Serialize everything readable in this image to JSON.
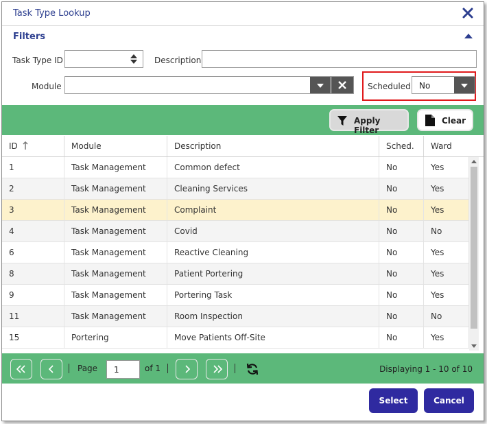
{
  "dialog": {
    "title": "Task Type Lookup"
  },
  "filters": {
    "heading": "Filters",
    "task_type_id_label": "Task Type ID",
    "task_type_id_value": "",
    "description_label": "Description",
    "description_value": "",
    "module_label": "Module",
    "module_value": "",
    "scheduled_label": "Scheduled",
    "scheduled_value": "No",
    "apply_label": "Apply Filter",
    "clear_label": "Clear"
  },
  "grid": {
    "columns": [
      "ID",
      "Module",
      "Description",
      "Sched.",
      "Ward"
    ],
    "rows": [
      {
        "id": "1",
        "module": "Task Management",
        "description": "Common defect",
        "sched": "No",
        "ward": "Yes"
      },
      {
        "id": "2",
        "module": "Task Management",
        "description": "Cleaning Services",
        "sched": "No",
        "ward": "Yes"
      },
      {
        "id": "3",
        "module": "Task Management",
        "description": "Complaint",
        "sched": "No",
        "ward": "Yes"
      },
      {
        "id": "4",
        "module": "Task Management",
        "description": "Covid",
        "sched": "No",
        "ward": "No"
      },
      {
        "id": "6",
        "module": "Task Management",
        "description": "Reactive Cleaning",
        "sched": "No",
        "ward": "Yes"
      },
      {
        "id": "8",
        "module": "Task Management",
        "description": "Patient Portering",
        "sched": "No",
        "ward": "Yes"
      },
      {
        "id": "9",
        "module": "Task Management",
        "description": "Portering Task",
        "sched": "No",
        "ward": "Yes"
      },
      {
        "id": "11",
        "module": "Task Management",
        "description": "Room Inspection",
        "sched": "No",
        "ward": "No"
      },
      {
        "id": "15",
        "module": "Portering",
        "description": "Move Patients Off-Site",
        "sched": "No",
        "ward": "Yes"
      }
    ],
    "selected_row_index": 2
  },
  "pager": {
    "page_label": "Page",
    "page_value": "1",
    "of_label": "of 1",
    "displaying": "Displaying 1 - 10 of 10"
  },
  "footer": {
    "select_label": "Select",
    "cancel_label": "Cancel"
  },
  "colors": {
    "accent": "#2c3e8f",
    "green_bar": "#5cb87a",
    "selected_row": "#fdf2cc",
    "primary_button": "#2f2aa0",
    "highlight_box": "#e0191b"
  }
}
